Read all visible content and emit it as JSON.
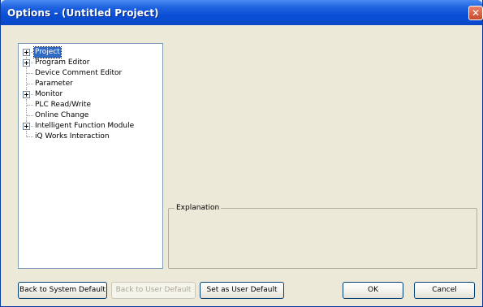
{
  "window": {
    "title": "Options - (Untitled Project)"
  },
  "tree": {
    "items": [
      {
        "label": "Project",
        "expandable": true,
        "selected": true
      },
      {
        "label": "Program Editor",
        "expandable": true,
        "selected": false
      },
      {
        "label": "Device Comment Editor",
        "expandable": false,
        "selected": false
      },
      {
        "label": "Parameter",
        "expandable": false,
        "selected": false
      },
      {
        "label": "Monitor",
        "expandable": true,
        "selected": false
      },
      {
        "label": "PLC Read/Write",
        "expandable": false,
        "selected": false
      },
      {
        "label": "Online Change",
        "expandable": false,
        "selected": false
      },
      {
        "label": "Intelligent Function Module",
        "expandable": true,
        "selected": false
      },
      {
        "label": "iQ Works Interaction",
        "expandable": false,
        "selected": false
      }
    ]
  },
  "explanation": {
    "label": "Explanation"
  },
  "buttons": {
    "back_to_system_default": "Back to System Default",
    "back_to_user_default": "Back to User Default",
    "set_as_user_default": "Set as User Default",
    "ok": "OK",
    "cancel": "Cancel"
  }
}
